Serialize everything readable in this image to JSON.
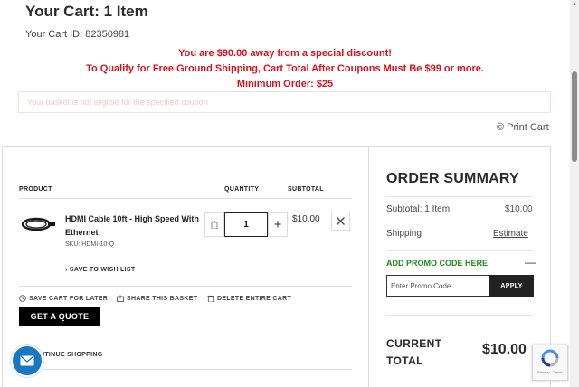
{
  "header": {
    "title": "Your Cart: 1 Item",
    "cart_id": "Your Cart ID: 82350981"
  },
  "notices": {
    "discount": "You are $90.00 away from a special discount!",
    "shipping": "To Qualify for Free Ground Shipping, Cart Total After Coupons Must Be $99 or more.",
    "minimum": "Minimum Order: $25",
    "coupon_error": "Your basket is not eligible for the specified coupon"
  },
  "print_cart": "Print Cart",
  "table": {
    "headers": [
      "PRODUCT",
      "QUANTITY",
      "SUBTOTAL"
    ]
  },
  "item": {
    "name": "HDMI Cable 10ft - High Speed With Ethernet",
    "sku": "SKU: HDMI-10-Q",
    "quantity": "1",
    "subtotal": "$10.00",
    "wishlist": "SAVE TO WISH LIST"
  },
  "actions": {
    "save_later": "SAVE CART FOR LATER",
    "share": "SHARE THIS BASKET",
    "delete": "DELETE ENTIRE CART",
    "quote": "GET A QUOTE",
    "continue": "NTINUE SHOPPING"
  },
  "summary": {
    "title": "ORDER SUMMARY",
    "subtotal_label": "Subtotal: 1 Item",
    "subtotal_value": "$10.00",
    "shipping_label": "Shipping",
    "shipping_value": "Estimate",
    "promo_label": "ADD PROMO CODE HERE",
    "promo_toggle": "—",
    "promo_placeholder": "Enter Promo Code",
    "apply": "APPLY",
    "current_label": "CURRENT TOTAL",
    "current_value": "$10.00"
  },
  "recaptcha": "Privacy - Terms",
  "colors": {
    "alert": "#e0101a",
    "promo": "#1f8a1f",
    "chat": "#1a78c2"
  }
}
